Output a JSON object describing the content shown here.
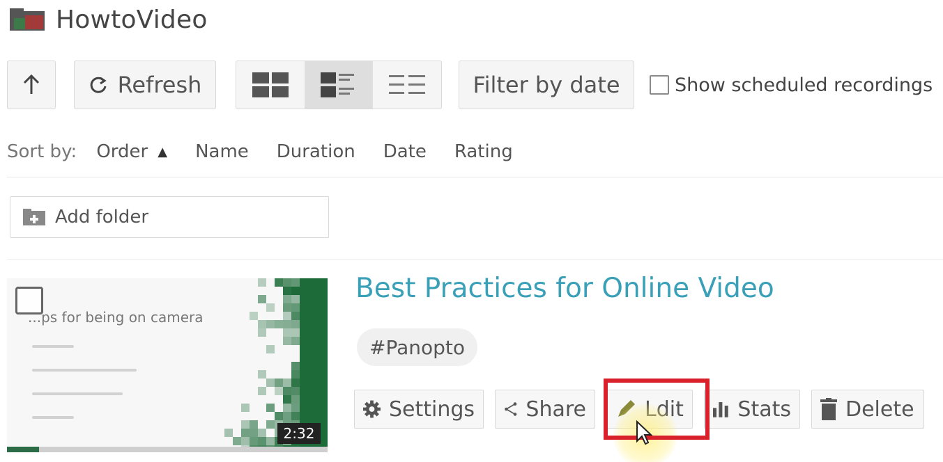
{
  "header": {
    "title": "HowtoVideo",
    "icon": "folder-icon"
  },
  "toolbar": {
    "up_icon": "arrow-up-icon",
    "refresh_label": "Refresh",
    "view_modes": [
      "grid-view",
      "detail-view",
      "list-view"
    ],
    "active_view": "detail-view",
    "filter_label": "Filter by date",
    "show_scheduled_label": "Show scheduled recordings",
    "show_scheduled_checked": false
  },
  "sort": {
    "label": "Sort by:",
    "options": [
      "Order",
      "Name",
      "Duration",
      "Date",
      "Rating"
    ],
    "active": "Order",
    "direction": "ascending"
  },
  "add_folder": {
    "label": "Add folder"
  },
  "video": {
    "title": "Best Practices for Online Video",
    "tag": "#Panopto",
    "thumbnail_heading": "...ps for being on camera",
    "duration": "2:32",
    "progress": 0.1,
    "actions": {
      "settings": "Settings",
      "share": "Share",
      "edit": "Ldit",
      "stats": "Stats",
      "delete": "Delete"
    }
  },
  "colors": {
    "accent_title": "#3aa0b8",
    "highlight": "#d8212b",
    "thumbnail_green": "#1e6b3a"
  }
}
